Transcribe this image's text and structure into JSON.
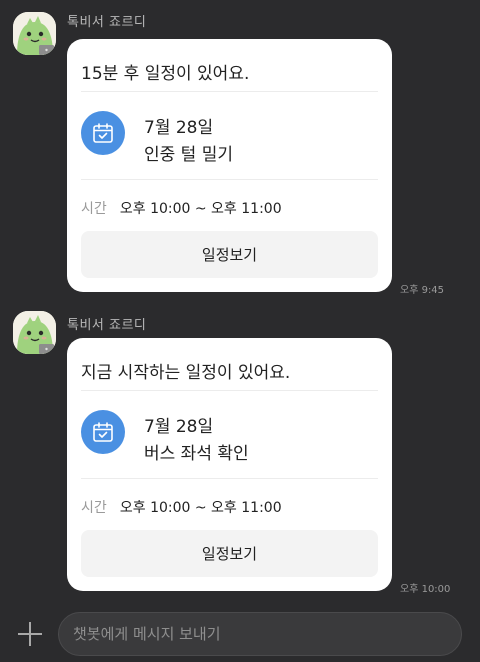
{
  "messages": [
    {
      "sender": "톡비서 죠르디",
      "title": "15분 후 일정이 있어요.",
      "date": "7월 28일",
      "event": "인중 털 밀기",
      "time_label": "시간",
      "time_value": "오후 10:00 ~ 오후 11:00",
      "button_label": "일정보기",
      "timestamp": "오후 9:45"
    },
    {
      "sender": "톡비서 죠르디",
      "title": "지금 시작하는 일정이 있어요.",
      "date": "7월 28일",
      "event": "버스 좌석 확인",
      "time_label": "시간",
      "time_value": "오후 10:00 ~ 오후 11:00",
      "button_label": "일정보기",
      "timestamp": "오후 10:00"
    }
  ],
  "input": {
    "placeholder": "챗봇에게 메시지 보내기",
    "value": ""
  },
  "icons": {
    "avatar": "jordy-dinosaur-avatar",
    "calendar": "calendar-check-icon",
    "add": "plus-icon"
  },
  "colors": {
    "background": "#2b2b2d",
    "bubble": "#ffffff",
    "accent": "#4a90e2",
    "avatar_green": "#9fd27e"
  }
}
